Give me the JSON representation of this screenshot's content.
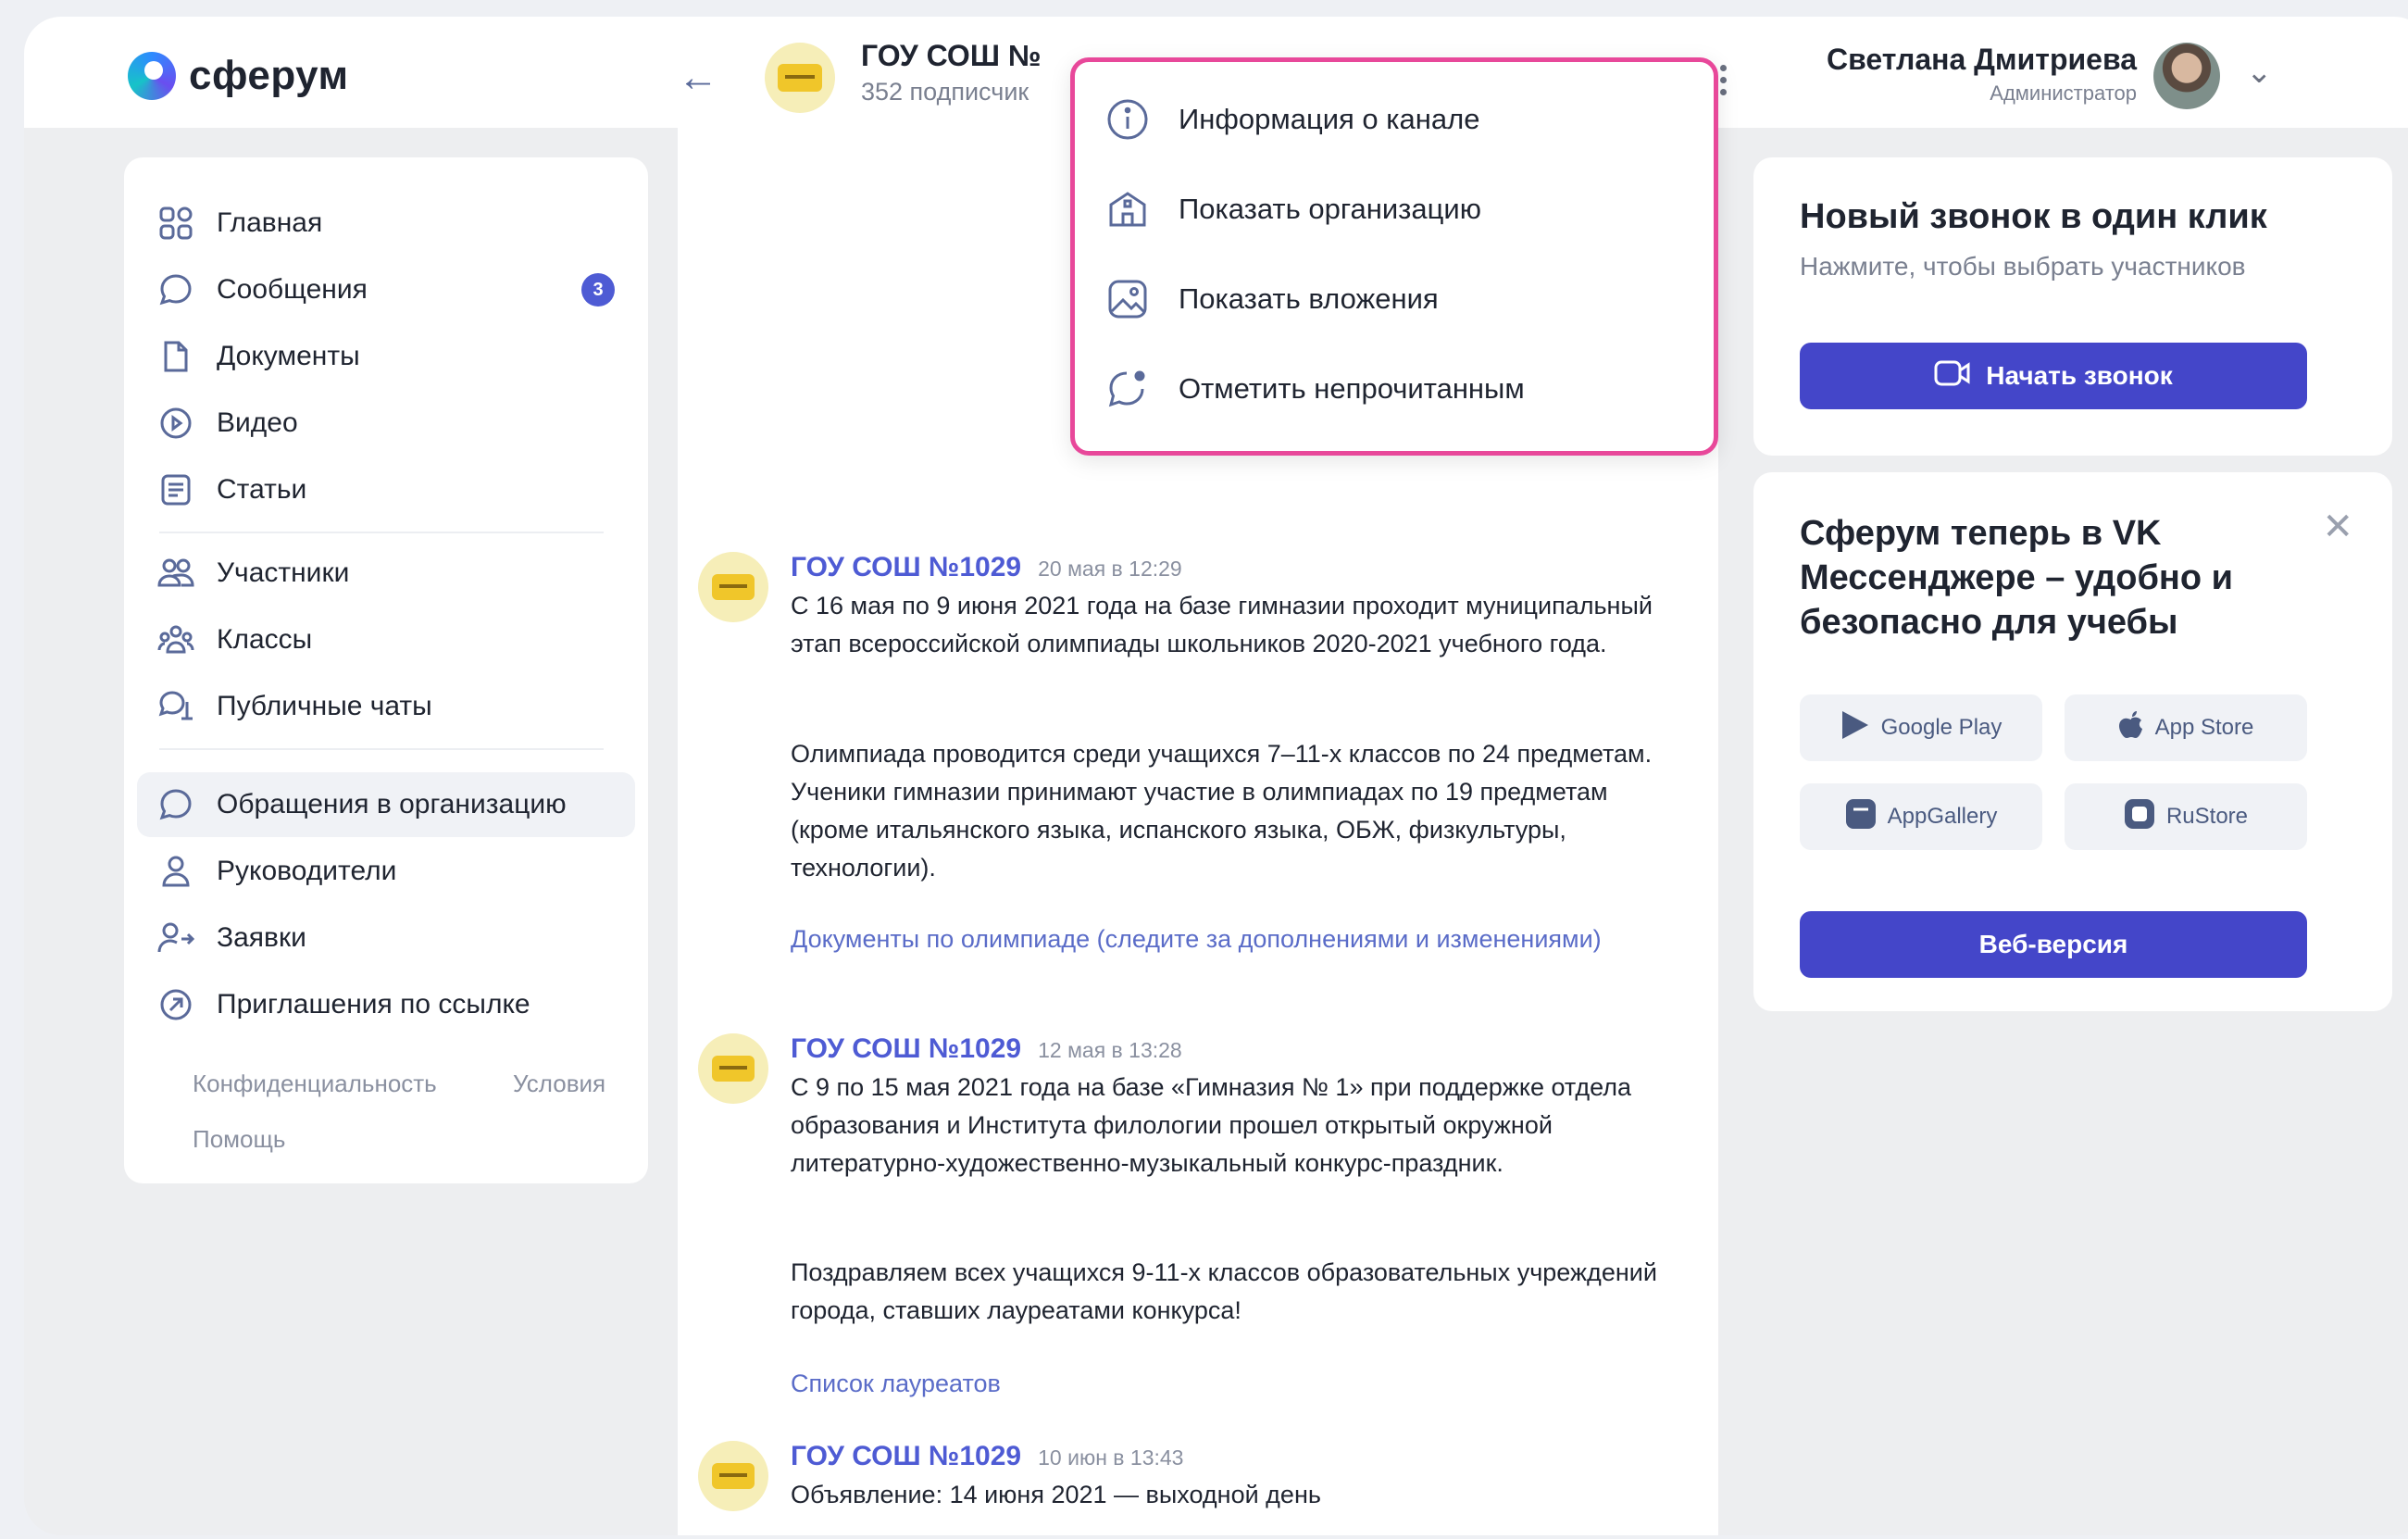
{
  "app": {
    "logo_text": "сферум"
  },
  "header": {
    "channel_title": "ГОУ СОШ №",
    "channel_subscribers": "352 подписчик",
    "user_name": "Светлана Дмитриева",
    "user_role": "Администратор"
  },
  "sidebar": {
    "items": [
      {
        "label": "Главная",
        "icon": "grid-icon"
      },
      {
        "label": "Сообщения",
        "icon": "chat-bubble-icon",
        "badge": "3"
      },
      {
        "label": "Документы",
        "icon": "document-icon"
      },
      {
        "label": "Видео",
        "icon": "play-circle-icon"
      },
      {
        "label": "Статьи",
        "icon": "article-icon"
      },
      {
        "label": "Участники",
        "icon": "users-icon"
      },
      {
        "label": "Классы",
        "icon": "group-icon"
      },
      {
        "label": "Публичные чаты",
        "icon": "public-chat-icon"
      },
      {
        "label": "Обращения в организацию",
        "icon": "chat-bubble-icon"
      },
      {
        "label": "Руководители",
        "icon": "person-icon"
      },
      {
        "label": "Заявки",
        "icon": "person-arrow-icon"
      },
      {
        "label": "Приглашения по ссылке",
        "icon": "link-arrow-icon"
      }
    ],
    "footer": {
      "privacy": "Конфиденциальность",
      "terms": "Условия",
      "help": "Помощь"
    }
  },
  "menu": {
    "items": [
      {
        "label": "Информация о канале",
        "icon": "info-icon"
      },
      {
        "label": "Показать организацию",
        "icon": "building-icon"
      },
      {
        "label": "Показать вложения",
        "icon": "image-icon"
      },
      {
        "label": "Отметить непрочитанным",
        "icon": "unread-chat-icon"
      }
    ]
  },
  "posts": [
    {
      "author": "ГОУ СОШ №1029",
      "date": "20 мая в 12:29",
      "text1": "С 16 мая по 9 июня 2021 года на базе гимназии проходит муниципальный этап всероссийской олимпиады школьников 2020-2021 учебного года.",
      "text2": "Олимпиада проводится среди учащихся 7–11-х классов по 24 предметам. Ученики гимназии принимают участие в олимпиадах по 19 предметам (кроме итальянского языка, испанского языка, ОБЖ, физкультуры, технологии).",
      "link": "Документы по олимпиаде (следите за дополнениями и изменениями)"
    },
    {
      "author": "ГОУ СОШ №1029",
      "date": "12 мая в 13:28",
      "text1": "С 9 по 15 мая 2021 года на базе «Гимназия № 1» при поддержке отдела образования и Института филологии прошел открытый окружной литературно-художественно-музыкальный конкурс-праздник.",
      "text2": "Поздравляем всех учащихся 9-11-х классов образовательных учреждений города, ставших лауреатами конкурса!",
      "link": "Список лауреатов"
    },
    {
      "author": "ГОУ СОШ №1029",
      "date": "10 июн в 13:43",
      "text1": "Объявление: 14 июня 2021 — выходной день"
    }
  ],
  "call_card": {
    "title": "Новый звонок в один клик",
    "subtitle": "Нажмите, чтобы выбрать участников",
    "button": "Начать звонок"
  },
  "promo_card": {
    "title": "Сферум теперь в VK Мессенджере – удобно и безопасно для учебы",
    "stores": [
      "Google Play",
      "App Store",
      "AppGallery",
      "RuStore"
    ],
    "web_button": "Веб-версия"
  },
  "colors": {
    "accent": "#4446c9",
    "link": "#5a6cc8",
    "highlight": "#e8489a"
  }
}
